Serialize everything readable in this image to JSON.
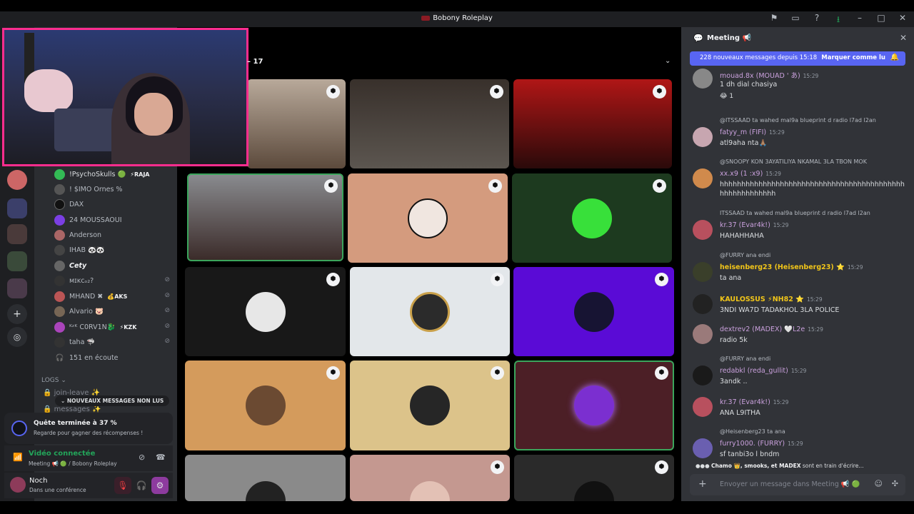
{
  "app": {
    "title": "Bobony Roleplay"
  },
  "stage": {
    "participant_count": "– 17"
  },
  "members": [
    {
      "name": "!PsychoSkulls 🟢",
      "tag": "⚡RAJA",
      "color": "#3b5"
    },
    {
      "name": "! $IMO Ornes %",
      "tag": "",
      "color": "#555"
    },
    {
      "name": "DAX",
      "tag": "",
      "color": "#222"
    },
    {
      "name": "24 MOUSSAOUI",
      "tag": "",
      "color": "#7b3fe4"
    },
    {
      "name": "Anderson",
      "tag": "",
      "color": "#a66"
    },
    {
      "name": "IHAB 🐼🐼",
      "tag": "",
      "color": "#444"
    },
    {
      "name": "Cety",
      "tag": "",
      "color": "#666"
    },
    {
      "name": "ᴍɪᴋᴄₒ₂?",
      "tag": "",
      "color": "#333"
    },
    {
      "name": "MHAND ✖",
      "tag": "💰AKS",
      "color": "#b55"
    },
    {
      "name": "Alvario 🐷",
      "tag": "",
      "color": "#765"
    },
    {
      "name": "ᴷᶻᴷ C0RV1N🐉",
      "tag": "⚡KZK",
      "color": "#a4b"
    },
    {
      "name": "taha 🦈",
      "tag": "",
      "color": "#333"
    },
    {
      "name": "151 en écoute",
      "tag": "",
      "color": "#2b2d31"
    }
  ],
  "sidebar": {
    "logs_label": "LOGS ⌄",
    "channel_1": "join-leave ✨",
    "channel_2": "messages ✨",
    "unread_pill": "⌄ NOUVEAUX MESSAGES NON LUS"
  },
  "quest": {
    "title": "Quête terminée à 37 %",
    "subtitle": "Regarde pour gagner des récompenses !"
  },
  "voice": {
    "status": "Vidéo connectée",
    "location": "Meeting 📢 🟢 / Bobony Roleplay"
  },
  "user": {
    "name": "Noch",
    "status": "Dans une conférence"
  },
  "chat": {
    "title": "Meeting 📢",
    "new_messages": "228 nouveaux messages depuis 15:18",
    "mark_read": "Marquer comme lu",
    "typing_names": "Chamo 👑, smooks, et MADEX",
    "typing_suffix": " sont en train d'écrire...",
    "composer_placeholder": "Envoyer un message dans Meeting 📢 🟢",
    "messages": [
      {
        "reply": "",
        "author": "mouad.8x (MOUAD ' あ)",
        "author_color": "#c9a0dc",
        "time": "15:29",
        "body": "1 dh dial chasiya",
        "reaction": "😂 1"
      },
      {
        "reply": "@ITSSAAD ta wahed mal9a blueprint d radio l7ad l2an",
        "author": "fatyy_m (FIFI)",
        "author_color": "#c9a0dc",
        "time": "15:29",
        "body": "atl9aha nta🙏🏽",
        "reaction": ""
      },
      {
        "reply": "@SNOOPY KON 3AYATILIYA NKAMAL 3LA TBON MOK",
        "author": "xx.x9 (1 :x9)",
        "author_color": "#c9a0dc",
        "time": "15:29",
        "body": "hhhhhhhhhhhhhhhhhhhhhhhhhhhhhhhhhhhhhhhhhhhhhhhhhhhhhhhh",
        "reaction": ""
      },
      {
        "reply": "ITSSAAD ta wahed mal9a blueprint d radio l7ad l2an",
        "author": "kr.37 (Evar4k!)",
        "author_color": "#c9a0dc",
        "time": "15:29",
        "body": "HAHAHHAHA",
        "reaction": ""
      },
      {
        "reply": "@FURRY ana endi",
        "author": "heisenberg23 (Heisenberg23) ⭐",
        "author_color": "#f0c419",
        "time": "15:29",
        "body": "ta ana",
        "reaction": ""
      },
      {
        "reply": "",
        "author": "KAULOSSUS ⚡NH82 ⭐",
        "author_color": "#f0c419",
        "time": "15:29",
        "body": "3NDI WA7D TADAKHOL 3LA POLICE",
        "reaction": ""
      },
      {
        "reply": "",
        "author": "dextrev2 (MADEX) 🤍L2e",
        "author_color": "#c9a0dc",
        "time": "15:29",
        "body": "radio 5k",
        "reaction": ""
      },
      {
        "reply": "@FURRY ana endi",
        "author": "redabkl (reda_gullit)",
        "author_color": "#c9a0dc",
        "time": "15:29",
        "body": "3andk ..",
        "reaction": ""
      },
      {
        "reply": "",
        "author": "kr.37 (Evar4k!)",
        "author_color": "#c9a0dc",
        "time": "15:29",
        "body": "ANA L9ITHA",
        "reaction": ""
      },
      {
        "reply": "@Heisenberg23 ta ana",
        "author": "furry1000. (FURRY)",
        "author_color": "#c9a0dc",
        "time": "15:29",
        "body": "sf tanbi3o l bndm",
        "reaction": ""
      }
    ]
  }
}
